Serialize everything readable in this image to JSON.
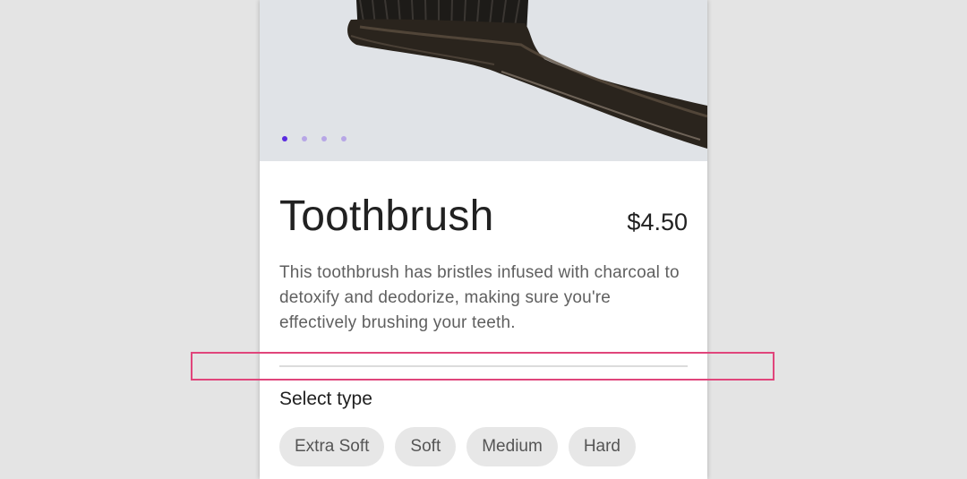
{
  "product": {
    "title": "Toothbrush",
    "price": "$4.50",
    "description": "This toothbrush has bristles infused with charcoal to detoxify and deodorize, making sure you're effectively brushing your teeth.",
    "image": {
      "subject": "charcoal toothbrush",
      "carousel_count": 4,
      "active_index": 0
    }
  },
  "type_section": {
    "label": "Select type",
    "options": [
      "Extra Soft",
      "Soft",
      "Medium",
      "Hard"
    ]
  },
  "colors": {
    "accent": "#5a2be0",
    "dot_inactive": "#b7a6e6",
    "highlight": "#e0457b",
    "background": "#e4e4e4",
    "hero_background": "#e0e3e7"
  }
}
